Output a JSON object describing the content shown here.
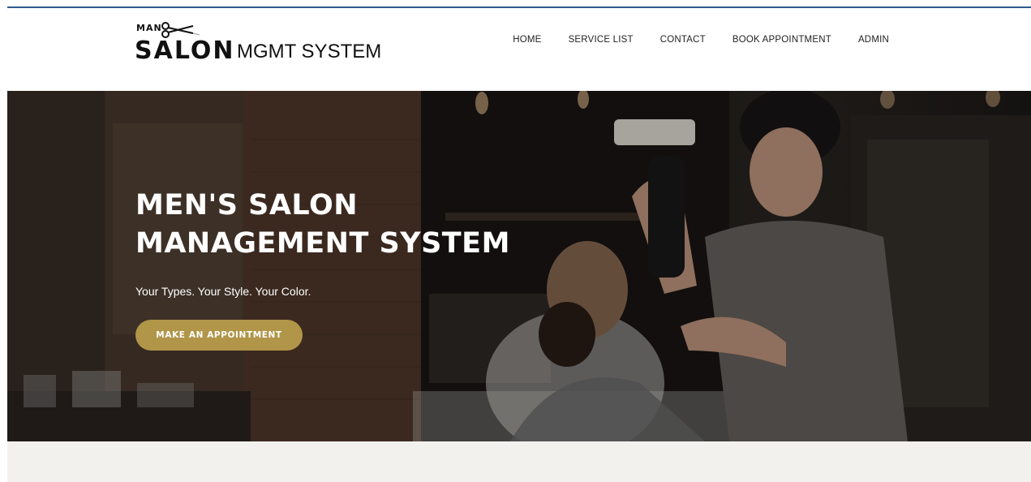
{
  "logo": {
    "top_text": "MAN",
    "main_text": "SALON",
    "side_text": "MGMT SYSTEM",
    "icon": "scissors-icon"
  },
  "nav": {
    "items": [
      {
        "label": "HOME"
      },
      {
        "label": "SERVICE LIST"
      },
      {
        "label": "CONTACT"
      },
      {
        "label": "BOOK APPOINTMENT"
      },
      {
        "label": "ADMIN"
      }
    ]
  },
  "hero": {
    "title_line1": "MEN'S SALON",
    "title_line2": "MANAGEMENT SYSTEM",
    "subtitle": "Your Types. Your Style. Your Color.",
    "cta_label": "MAKE AN APPOINTMENT"
  },
  "colors": {
    "accent_gold": "#b19548",
    "top_rule": "#2b5a8c",
    "footer_band": "#f3f1ee"
  }
}
